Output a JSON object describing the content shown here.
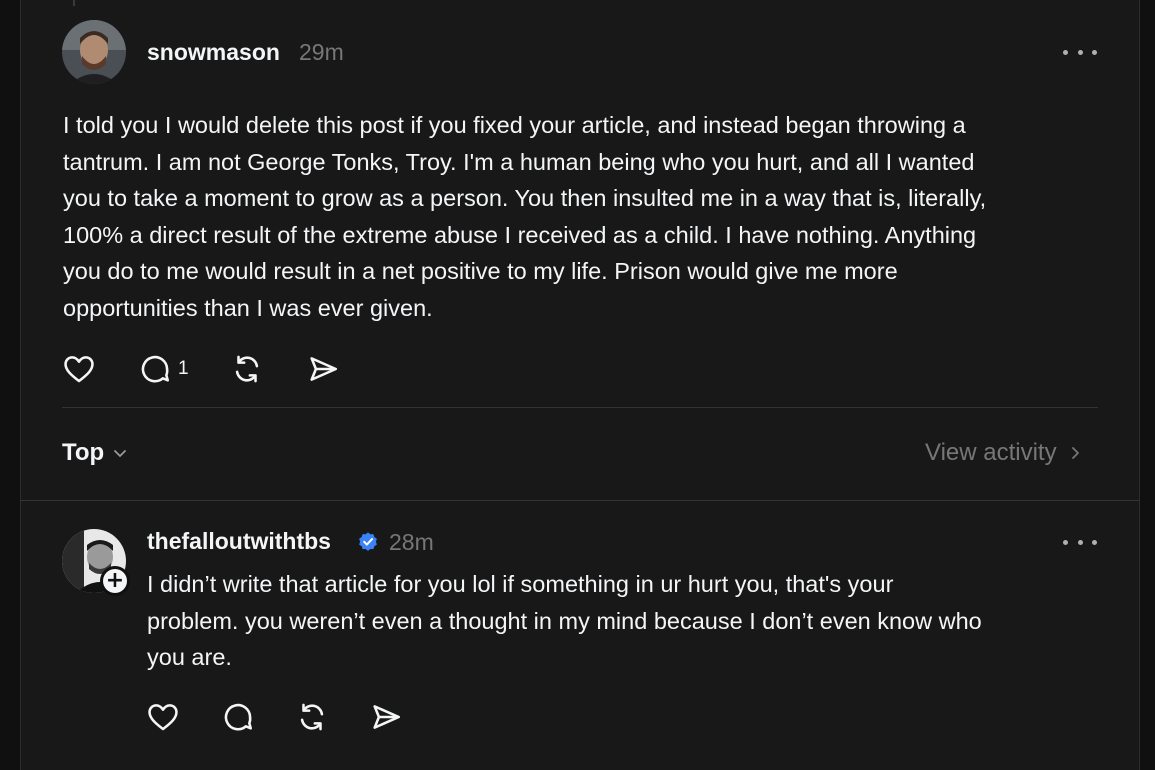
{
  "post": {
    "username": "snowmason",
    "time": "29m",
    "lines": [
      "I told you I would delete this post if you fixed your article, and instead began throwing a",
      "tantrum. I am not George Tonks, Troy. I'm a human being who you hurt, and all I wanted",
      "you to take a moment to grow as a person. You then insulted me in a way that is, literally,",
      "100% a direct result of the extreme abuse I received as a child. I have nothing. Anything",
      "you do to me would result in a net positive to my life. Prison would give me more",
      "opportunities than I was ever given."
    ],
    "reply_count": "1",
    "icons": [
      "heart-icon",
      "comment-icon",
      "repost-icon",
      "share-icon",
      "more-icon"
    ]
  },
  "replies_bar": {
    "sort_label": "Top",
    "view_activity_label": "View activity"
  },
  "reply": {
    "username": "thefalloutwithtbs",
    "verified": true,
    "time": "28m",
    "lines": [
      "I didn’t write that article for you lol if something in ur hurt you, that's your",
      "problem. you weren’t even a thought in my mind because I don’t even know who",
      "you are."
    ],
    "follow_symbol": "+",
    "icons": [
      "heart-icon",
      "comment-icon",
      "repost-icon",
      "share-icon",
      "more-icon"
    ]
  },
  "colors": {
    "background": "#101010",
    "panel": "#181818",
    "text": "#f3f5f7",
    "muted": "#777777",
    "verified_blue": "#3b82f6"
  }
}
